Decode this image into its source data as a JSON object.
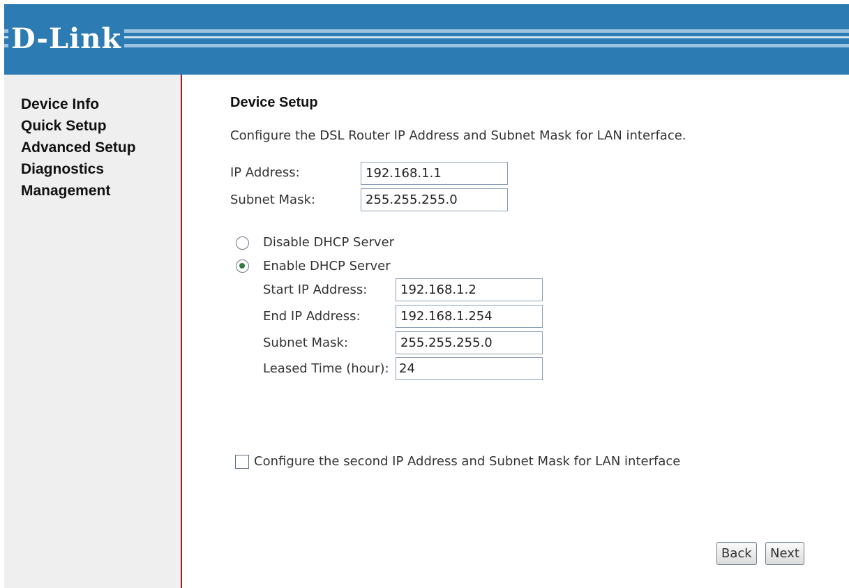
{
  "brand": {
    "logo_text": "D-Link",
    "header_color": "#2d7bb3",
    "divider_color": "#a01b24"
  },
  "sidebar": {
    "items": [
      {
        "label": "Device Info"
      },
      {
        "label": "Quick Setup"
      },
      {
        "label": "Advanced Setup"
      },
      {
        "label": "Diagnostics"
      },
      {
        "label": "Management"
      }
    ]
  },
  "main": {
    "title": "Device Setup",
    "description": "Configure the DSL Router IP Address and Subnet Mask for LAN interface.",
    "ip_address": {
      "label": "IP Address:",
      "value": "192.168.1.1"
    },
    "subnet_mask": {
      "label": "Subnet Mask:",
      "value": "255.255.255.0"
    },
    "dhcp": {
      "disable_label": "Disable DHCP Server",
      "enable_label": "Enable DHCP Server",
      "selected": "enable",
      "start_ip": {
        "label": "Start IP Address:",
        "value": "192.168.1.2"
      },
      "end_ip": {
        "label": "End IP Address:",
        "value": "192.168.1.254"
      },
      "subnet_mask": {
        "label": "Subnet Mask:",
        "value": "255.255.255.0"
      },
      "leased_time": {
        "label": "Leased Time (hour):",
        "value": "24"
      }
    },
    "second_ip": {
      "label": "Configure the second IP Address and Subnet Mask for LAN interface",
      "checked": false
    },
    "buttons": {
      "back": "Back",
      "next": "Next"
    }
  }
}
